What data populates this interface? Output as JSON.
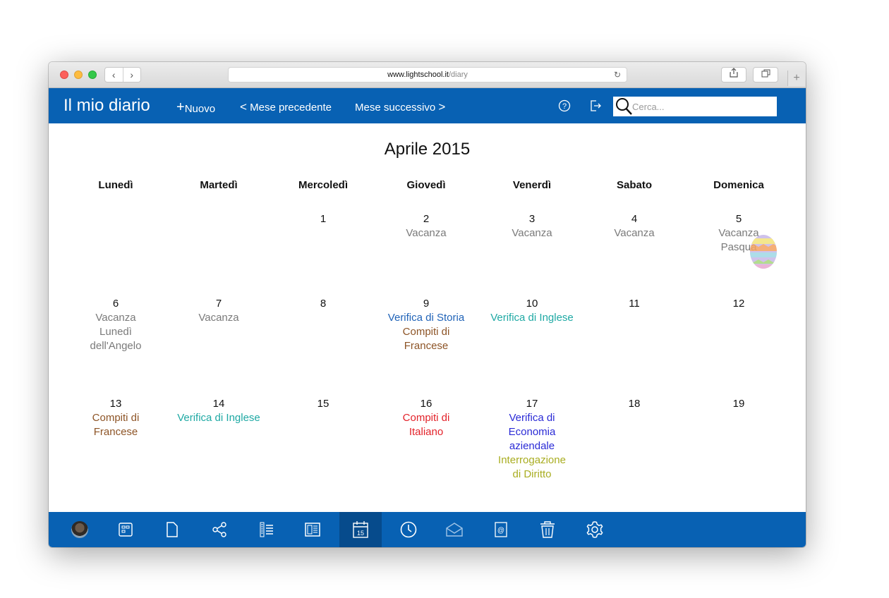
{
  "browser": {
    "url_domain": "www.lightschool.it",
    "url_path": "/diary",
    "back": "‹",
    "forward": "›"
  },
  "header": {
    "title": "Il mio diario",
    "new_label": "Nuovo",
    "prev_label": "Mese precedente",
    "next_label": "Mese successivo",
    "search_placeholder": "Cerca..."
  },
  "calendar": {
    "month_title": "Aprile 2015",
    "weekdays": [
      "Lunedì",
      "Martedì",
      "Mercoledì",
      "Giovedì",
      "Venerdì",
      "Sabato",
      "Domenica"
    ],
    "weeks": [
      [
        {
          "day": "",
          "events": []
        },
        {
          "day": "",
          "events": []
        },
        {
          "day": "1",
          "events": []
        },
        {
          "day": "2",
          "events": [
            {
              "text": "Vacanza",
              "color": "gray"
            }
          ]
        },
        {
          "day": "3",
          "events": [
            {
              "text": "Vacanza",
              "color": "gray"
            }
          ]
        },
        {
          "day": "4",
          "events": [
            {
              "text": "Vacanza",
              "color": "gray"
            }
          ]
        },
        {
          "day": "5",
          "events": [
            {
              "text": "Vacanza",
              "color": "gray"
            },
            {
              "text": "Pasqua",
              "color": "gray"
            }
          ]
        }
      ],
      [
        {
          "day": "6",
          "events": [
            {
              "text": "Vacanza",
              "color": "gray"
            },
            {
              "text": "Lunedì dell'Angelo",
              "color": "gray"
            }
          ]
        },
        {
          "day": "7",
          "events": [
            {
              "text": "Vacanza",
              "color": "gray"
            }
          ]
        },
        {
          "day": "8",
          "events": []
        },
        {
          "day": "9",
          "events": [
            {
              "text": "Verifica di Storia",
              "color": "blue"
            },
            {
              "text": "Compiti di Francese",
              "color": "brown"
            }
          ]
        },
        {
          "day": "10",
          "events": [
            {
              "text": "Verifica di Inglese",
              "color": "teal"
            }
          ]
        },
        {
          "day": "11",
          "events": []
        },
        {
          "day": "12",
          "events": []
        }
      ],
      [
        {
          "day": "13",
          "events": [
            {
              "text": "Compiti di Francese",
              "color": "brown"
            }
          ]
        },
        {
          "day": "14",
          "events": [
            {
              "text": "Verifica di Inglese",
              "color": "teal"
            }
          ]
        },
        {
          "day": "15",
          "events": []
        },
        {
          "day": "16",
          "events": [
            {
              "text": "Compiti di Italiano",
              "color": "red"
            }
          ]
        },
        {
          "day": "17",
          "events": [
            {
              "text": "Verifica di Economia aziendale",
              "color": "indigo"
            },
            {
              "text": "Interrogazione di Diritto",
              "color": "olive"
            }
          ]
        },
        {
          "day": "18",
          "events": []
        },
        {
          "day": "19",
          "events": []
        }
      ]
    ]
  },
  "colors": {
    "brand_blue": "#0861b3",
    "active_tab": "#064b8c"
  },
  "bottom_nav": [
    "avatar",
    "desktop-icon",
    "file-icon",
    "share-icon",
    "register-list-icon",
    "reader-icon",
    "calendar-icon",
    "clock-icon",
    "mail-icon",
    "contacts-icon",
    "trash-icon",
    "settings-icon"
  ],
  "calendar_icon_day": "15"
}
